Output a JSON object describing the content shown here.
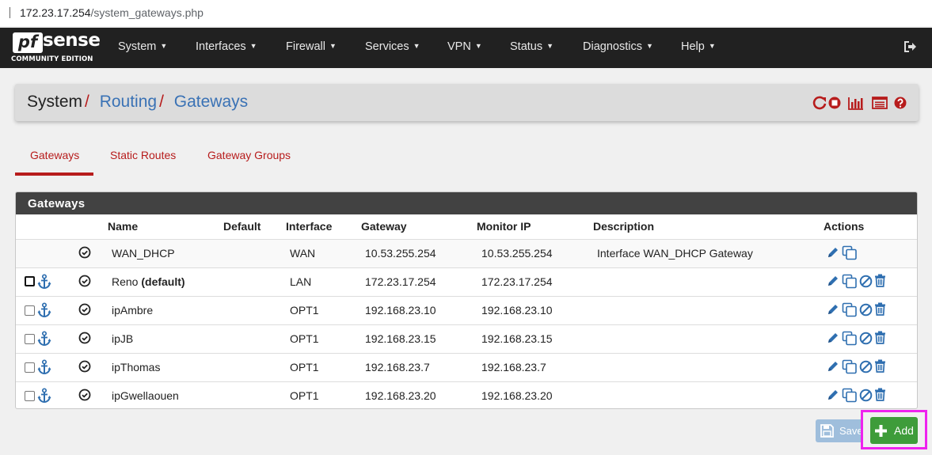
{
  "browser": {
    "url_host": "172.23.17.254",
    "url_path": "/system_gateways.php"
  },
  "brand": {
    "logo_pf": "pf",
    "logo_sense": "sense",
    "edition": "COMMUNITY EDITION"
  },
  "nav": {
    "items": [
      {
        "label": "System"
      },
      {
        "label": "Interfaces"
      },
      {
        "label": "Firewall"
      },
      {
        "label": "Services"
      },
      {
        "label": "VPN"
      },
      {
        "label": "Status"
      },
      {
        "label": "Diagnostics"
      },
      {
        "label": "Help"
      }
    ],
    "caret": "▼"
  },
  "breadcrumb": {
    "root": "System",
    "sep": "/",
    "level1": "Routing",
    "level2": "Gateways",
    "icons": [
      "reload-icon",
      "stop-icon",
      "chart-icon",
      "log-icon",
      "help-icon"
    ]
  },
  "tabs": [
    {
      "label": "Gateways",
      "active": true
    },
    {
      "label": "Static Routes",
      "active": false
    },
    {
      "label": "Gateway Groups",
      "active": false
    }
  ],
  "panel": {
    "title": "Gateways",
    "columns": [
      "Name",
      "Default",
      "Interface",
      "Gateway",
      "Monitor IP",
      "Description",
      "Actions"
    ],
    "rows": [
      {
        "name": "WAN_DHCP",
        "name_suffix": "",
        "interface": "WAN",
        "gateway": "10.53.255.254",
        "monitor": "10.53.255.254",
        "description": "Interface WAN_DHCP Gateway",
        "selectable": false
      },
      {
        "name": "Reno ",
        "name_suffix": "(default)",
        "interface": "LAN",
        "gateway": "172.23.17.254",
        "monitor": "172.23.17.254",
        "description": "",
        "selectable": true
      },
      {
        "name": "ipAmbre",
        "name_suffix": "",
        "interface": "OPT1",
        "gateway": "192.168.23.10",
        "monitor": "192.168.23.10",
        "description": "",
        "selectable": true
      },
      {
        "name": "ipJB",
        "name_suffix": "",
        "interface": "OPT1",
        "gateway": "192.168.23.15",
        "monitor": "192.168.23.15",
        "description": "",
        "selectable": true
      },
      {
        "name": "ipThomas",
        "name_suffix": "",
        "interface": "OPT1",
        "gateway": "192.168.23.7",
        "monitor": "192.168.23.7",
        "description": "",
        "selectable": true
      },
      {
        "name": "ipGwellaouen",
        "name_suffix": "",
        "interface": "OPT1",
        "gateway": "192.168.23.20",
        "monitor": "192.168.23.20",
        "description": "",
        "selectable": true
      }
    ]
  },
  "buttons": {
    "save_label": "Save",
    "add_label": "Add"
  },
  "colors": {
    "brand_red": "#b71c1c",
    "link_blue": "#3a72b5",
    "action_blue": "#2f6fb0",
    "add_green": "#3e9c3a",
    "highlight": "#ee22ee"
  }
}
